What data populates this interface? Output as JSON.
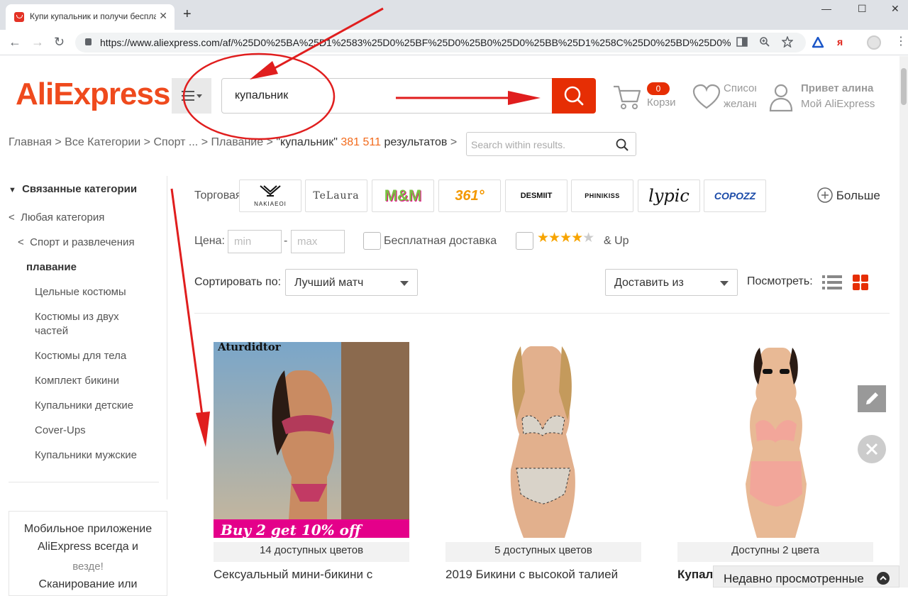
{
  "browser": {
    "tab_title": "Купи купальник и получи беспла",
    "close_tab": "✕",
    "new_tab": "+",
    "window_controls": [
      "—",
      "☐",
      "✕"
    ],
    "url": "https://www.aliexpress.com/af/%25D0%25BA%25D1%2583%25D0%25BF%25D0%25B0%25D0%25BB%25D1%258C%25D0%25BD%25D0%25...",
    "nav": {
      "back": "←",
      "forward": "→",
      "reload": "↻"
    },
    "extension_labels": {
      "yandex": "я"
    }
  },
  "header": {
    "logo_ali": "AliExpress",
    "search_value": "купальник",
    "cart_count": "0",
    "cart_label": "Корзина",
    "wishlist_line1": "Список",
    "wishlist_line2": "желаний",
    "account_greeting": "Привет алина",
    "account_link": "Мой AliExpress"
  },
  "breadcrumb": {
    "items": [
      "Главная",
      "Все Категории",
      "Спорт ...",
      "Плавание"
    ],
    "query": "\"купальник\"",
    "count": "381 511",
    "results_word": "результатов",
    "search_within_placeholder": "Search within results."
  },
  "sidebar": {
    "heading": "Связанные категории",
    "any_category": "Любая категория",
    "sport": "Спорт и развлечения",
    "current": "плавание",
    "items": [
      "Цельные костюмы",
      "Костюмы из двух",
      "частей",
      "Костюмы для тела",
      "Комплект бикини",
      "Купальники детские",
      "Cover-Ups",
      "Купальники мужские"
    ],
    "app_box": [
      "Мобильное приложение",
      "AliExpress всегда и",
      "везде!",
      "Сканирование или"
    ]
  },
  "filters": {
    "brand_label": "Торговая",
    "brands": [
      "NAKIAEOI",
      "TeLaura",
      "M&M",
      "361°",
      "DESMIIT",
      "PHINIKISS",
      "lypic",
      "COPOZZ"
    ],
    "more": "Больше",
    "price_label": "Цена:",
    "price_min_placeholder": "min",
    "price_max_placeholder": "max",
    "price_dash": "-",
    "free_shipping": "Бесплатная доставка",
    "stars_filled": "★★★★",
    "stars_empty": "★",
    "rating_suffix": "& Up",
    "sort_label": "Сортировать по:",
    "sort_value": "Лучший матч",
    "ship_from": "Доставить из",
    "view_label": "Посмотреть:"
  },
  "products": [
    {
      "colors": "14 доступных цветов",
      "name": "Сексуальный мини-бикини с",
      "brand_overlay": "Aturdidtor",
      "promo": "Buy 2 get 10% off"
    },
    {
      "colors": "5 доступных цветов",
      "name": "2019 Бикини с высокой талией",
      "brand_overlay": "",
      "promo": ""
    },
    {
      "colors": "Доступны 2 цвета",
      "name": "Купальник",
      "brand_overlay": "",
      "promo": ""
    }
  ],
  "recently_viewed": "Недавно просмотренные",
  "colors": {
    "accent": "#e62e04",
    "logo": "#ef4a1d",
    "logo_e": "#f39800",
    "count": "#f26a1b",
    "annotation": "#e01e1e"
  }
}
